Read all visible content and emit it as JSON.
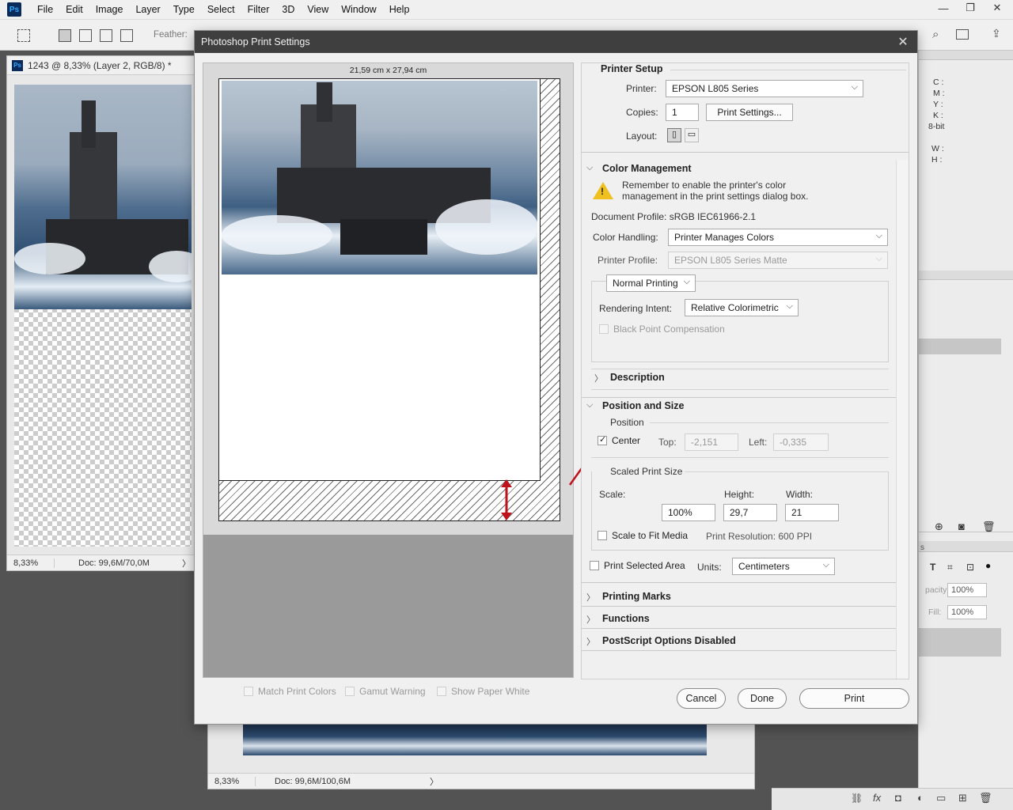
{
  "app": {
    "menu": [
      "File",
      "Edit",
      "Image",
      "Layer",
      "Type",
      "Select",
      "Filter",
      "3D",
      "View",
      "Window",
      "Help"
    ],
    "logo_text": "Ps",
    "options_feather_label": "Feather:",
    "win_minimize": "—",
    "win_restore": "❐",
    "win_close": "✕"
  },
  "documents": {
    "left": {
      "tab_title": "1243 @ 8,33% (Layer 2, RGB/8) *",
      "zoom": "8,33%",
      "doc_size": "Doc: 99,6M/70,0M",
      "status_arrow": "〉"
    },
    "bottom": {
      "zoom": "8,33%",
      "doc_size": "Doc: 99,6M/100,6M",
      "status_arrow": "〉"
    }
  },
  "right_dock": {
    "info_labels": [
      "C :",
      "M :",
      "Y :",
      "K :",
      "8-bit"
    ],
    "wh_labels": [
      "W :",
      "H :"
    ],
    "opacity_label": "pacity:",
    "opacity_value": "100%",
    "fill_label": "Fill:",
    "fill_value": "100%",
    "tab_fragment": "s"
  },
  "dialog": {
    "title": "Photoshop Print Settings",
    "close": "✕",
    "preview": {
      "paper_size": "21,59 cm x 27,94 cm",
      "match_print_colors": "Match Print Colors",
      "gamut_warning": "Gamut Warning",
      "show_paper_white": "Show Paper White"
    },
    "printer_setup": {
      "heading": "Printer Setup",
      "printer_label": "Printer:",
      "printer_value": "EPSON L805 Series",
      "copies_label": "Copies:",
      "copies_value": "1",
      "print_settings_btn": "Print Settings...",
      "layout_label": "Layout:"
    },
    "color_management": {
      "heading": "Color Management",
      "warning_line1": "Remember to enable the printer's color",
      "warning_line2": "management in the print settings dialog box.",
      "doc_profile": "Document Profile: sRGB IEC61966-2.1",
      "handling_label": "Color Handling:",
      "handling_value": "Printer Manages Colors",
      "profile_label": "Printer Profile:",
      "profile_value": "EPSON L805 Series Matte",
      "normal_printing": "Normal Printing",
      "intent_label": "Rendering Intent:",
      "intent_value": "Relative Colorimetric",
      "black_point": "Black Point Compensation",
      "description": "Description"
    },
    "position_size": {
      "heading": "Position and Size",
      "position_label": "Position",
      "center_label": "Center",
      "top_label": "Top:",
      "top_value": "-2,151",
      "left_label": "Left:",
      "left_value": "-0,335",
      "scaled_label": "Scaled Print Size",
      "scale_label": "Scale:",
      "scale_value": "100%",
      "height_label": "Height:",
      "height_value": "29,7",
      "width_label": "Width:",
      "width_value": "21",
      "fit_media": "Scale to Fit Media",
      "resolution": "Print Resolution: 600 PPI",
      "print_selected": "Print Selected Area",
      "units_label": "Units:",
      "units_value": "Centimeters"
    },
    "collapsed_sections": [
      "Printing Marks",
      "Functions",
      "PostScript Options Disabled"
    ],
    "buttons": {
      "cancel": "Cancel",
      "done": "Done",
      "print": "Print"
    },
    "annotation_color": "#c0121c"
  }
}
